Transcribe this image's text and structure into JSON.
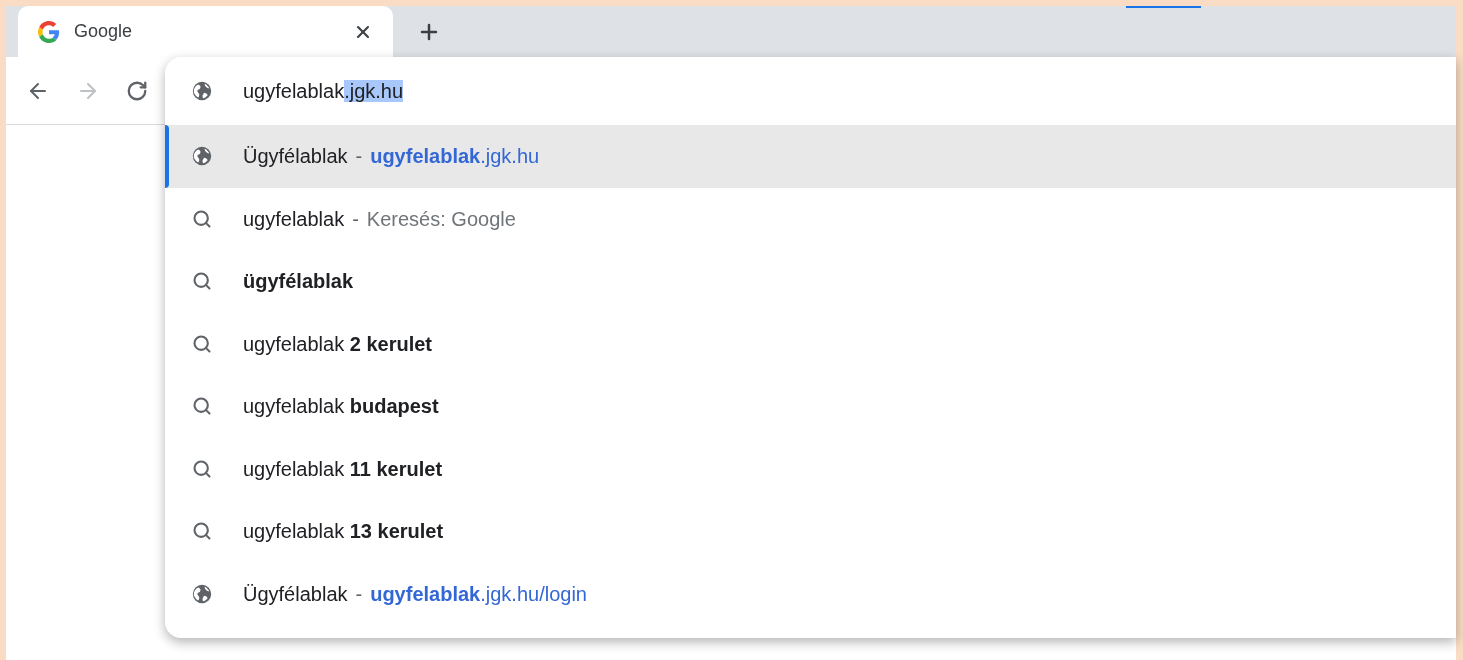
{
  "tab": {
    "title": "Google",
    "selected": true
  },
  "nav": {
    "back_disabled": false,
    "forward_disabled": true
  },
  "omnibox": {
    "typed": "ugyfelablak",
    "autocomplete": ".jgk.hu"
  },
  "suggestions": [
    {
      "kind": "url",
      "selected": true,
      "text": "Ügyfélablak",
      "separator": "-",
      "detail": "**ugyfelablak**.jgk.hu"
    },
    {
      "kind": "search",
      "selected": false,
      "text": "ugyfelablak",
      "separator": "-",
      "detail": "Keresés: Google"
    },
    {
      "kind": "search",
      "selected": false,
      "text": "**ügyfélablak**"
    },
    {
      "kind": "search",
      "selected": false,
      "text": "ugyfelablak **2 kerulet**"
    },
    {
      "kind": "search",
      "selected": false,
      "text": "ugyfelablak **budapest**"
    },
    {
      "kind": "search",
      "selected": false,
      "text": "ugyfelablak **11 kerulet**"
    },
    {
      "kind": "search",
      "selected": false,
      "text": "ugyfelablak **13 kerulet**"
    },
    {
      "kind": "url",
      "selected": false,
      "text": "Ügyfélablak",
      "separator": "-",
      "detail": "**ugyfelablak**.jgk.hu/login"
    }
  ]
}
